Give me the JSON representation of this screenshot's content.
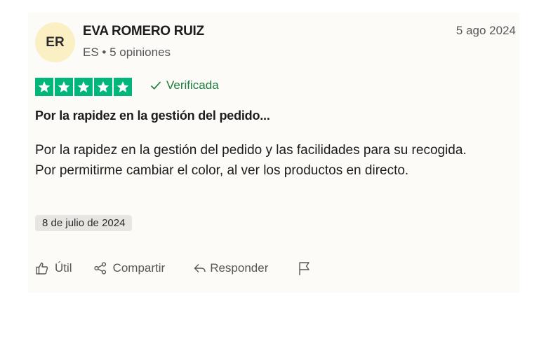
{
  "reviewer": {
    "initials": "ER",
    "name": "EVA ROMERO RUIZ",
    "meta": "ES • 5 opiniones"
  },
  "review": {
    "date": "5 ago 2024",
    "rating": 5,
    "rating_color": "#00b67a",
    "verified_label": "Verificada",
    "title": "Por la rapidez en la gestión del pedido...",
    "text": "Por la rapidez en la gestión del pedido y las facilidades para su recogida. Por permitirme cambiar el color, al ver los productos en directo.",
    "experience_date": "8 de julio de 2024"
  },
  "actions": {
    "useful_label": "Útil",
    "share_label": "Compartir",
    "reply_label": "Responder",
    "report_icon": "flag-icon"
  }
}
